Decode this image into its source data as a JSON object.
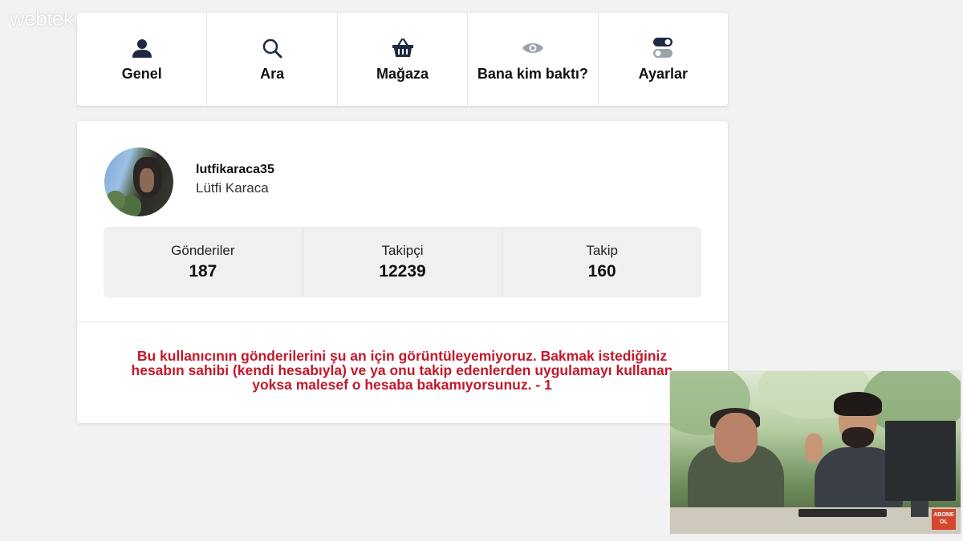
{
  "watermark": "webtekno",
  "nav": {
    "items": [
      {
        "label": "Genel",
        "icon": "user-icon"
      },
      {
        "label": "Ara",
        "icon": "search-icon"
      },
      {
        "label": "Mağaza",
        "icon": "basket-icon"
      },
      {
        "label": "Bana kim baktı?",
        "icon": "eye-icon"
      },
      {
        "label": "Ayarlar",
        "icon": "toggle-icon"
      }
    ]
  },
  "profile": {
    "username": "lutfikaraca35",
    "full_name": "Lütfi Karaca",
    "stats": [
      {
        "label": "Gönderiler",
        "value": "187"
      },
      {
        "label": "Takipçi",
        "value": "12239"
      },
      {
        "label": "Takip",
        "value": "160"
      }
    ],
    "notice": "Bu kullanıcının gönderilerini şu an için görüntüleyemiyoruz. Bakmak istediğiniz hesabın sahibi (kendi hesabıyla) ve ya onu takip edenlerden uygulamayı kullanan yoksa malesef o hesaba bakamıyorsunuz. - 1"
  },
  "video_overlay": {
    "badge": "ABONE OL"
  },
  "colors": {
    "accent_dark": "#1e2a44",
    "notice_red": "#c2182b",
    "eye_gray": "#9ba3ad"
  }
}
